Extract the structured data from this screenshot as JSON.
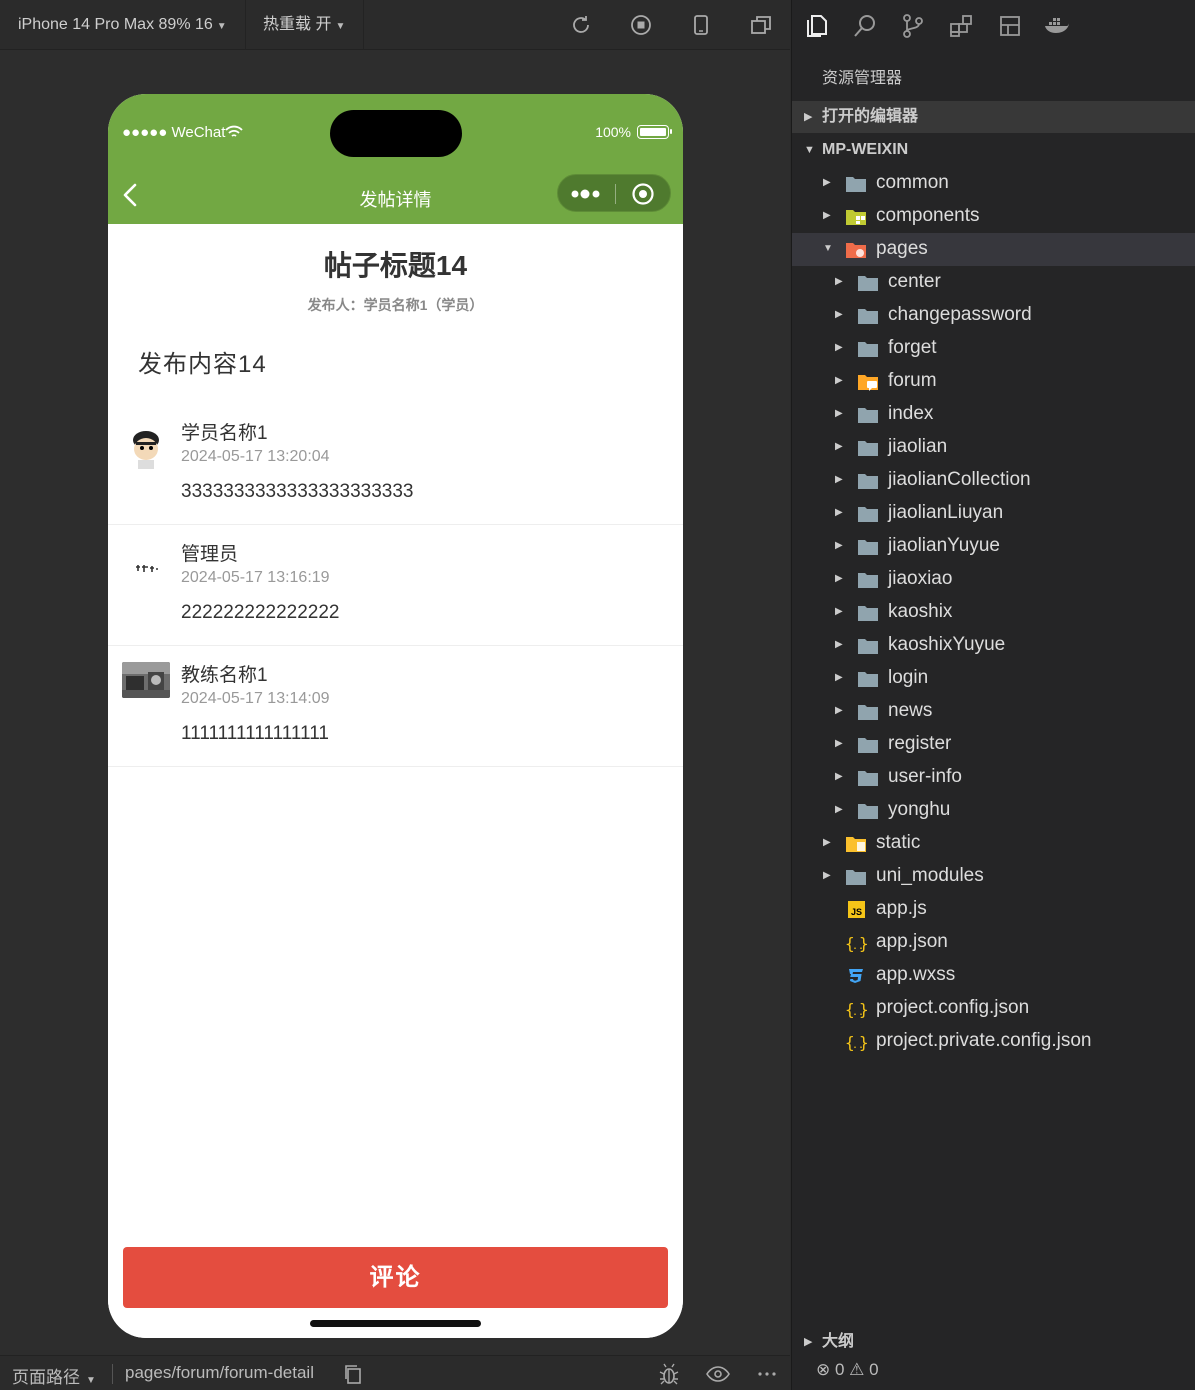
{
  "toolbar": {
    "device_label": "iPhone 14 Pro Max 89% 16",
    "hotreload_label": "热重载 开"
  },
  "phone": {
    "carrier": "●●●●● WeChat",
    "battery": "100%",
    "nav_title": "发帖详情",
    "header_color": "#72a843"
  },
  "post": {
    "title": "帖子标题14",
    "author": "发布人：学员名称1（学员）",
    "body": "发布内容14"
  },
  "comments": [
    {
      "name": "学员名称1",
      "time": "2024-05-17 13:20:04",
      "text": "3333333333333333333333"
    },
    {
      "name": "管理员",
      "time": "2024-05-17 13:16:19",
      "text": "222222222222222"
    },
    {
      "name": "教练名称1",
      "time": "2024-05-17 13:14:09",
      "text": "1111111111111111"
    }
  ],
  "footer": {
    "comment_button": "评论",
    "button_color": "#e44d3f"
  },
  "sim_bottom": {
    "path_label": "页面路径",
    "path_value": "pages/forum/forum-detail"
  },
  "explorer": {
    "title": "资源管理器",
    "open_editors": "打开的编辑器",
    "project": "MP-WEIXIN",
    "tree": [
      {
        "name": "common",
        "type": "folder"
      },
      {
        "name": "components",
        "type": "folder-components"
      },
      {
        "name": "pages",
        "type": "folder-pages",
        "expanded": true
      },
      {
        "name": "center",
        "type": "folder"
      },
      {
        "name": "changepassword",
        "type": "folder"
      },
      {
        "name": "forget",
        "type": "folder"
      },
      {
        "name": "forum",
        "type": "folder-forum"
      },
      {
        "name": "index",
        "type": "folder"
      },
      {
        "name": "jiaolian",
        "type": "folder"
      },
      {
        "name": "jiaolianCollection",
        "type": "folder"
      },
      {
        "name": "jiaolianLiuyan",
        "type": "folder"
      },
      {
        "name": "jiaolianYuyue",
        "type": "folder"
      },
      {
        "name": "jiaoxiao",
        "type": "folder"
      },
      {
        "name": "kaoshix",
        "type": "folder"
      },
      {
        "name": "kaoshixYuyue",
        "type": "folder"
      },
      {
        "name": "login",
        "type": "folder"
      },
      {
        "name": "news",
        "type": "folder"
      },
      {
        "name": "register",
        "type": "folder"
      },
      {
        "name": "user-info",
        "type": "folder"
      },
      {
        "name": "yonghu",
        "type": "folder"
      },
      {
        "name": "static",
        "type": "folder-static"
      },
      {
        "name": "uni_modules",
        "type": "folder"
      },
      {
        "name": "app.js",
        "type": "file-js"
      },
      {
        "name": "app.json",
        "type": "file-json"
      },
      {
        "name": "app.wxss",
        "type": "file-css"
      },
      {
        "name": "project.config.json",
        "type": "file-json"
      },
      {
        "name": "project.private.config.json",
        "type": "file-json"
      }
    ],
    "outline": "大纲",
    "problems": "⊗ 0 ⚠ 0"
  }
}
